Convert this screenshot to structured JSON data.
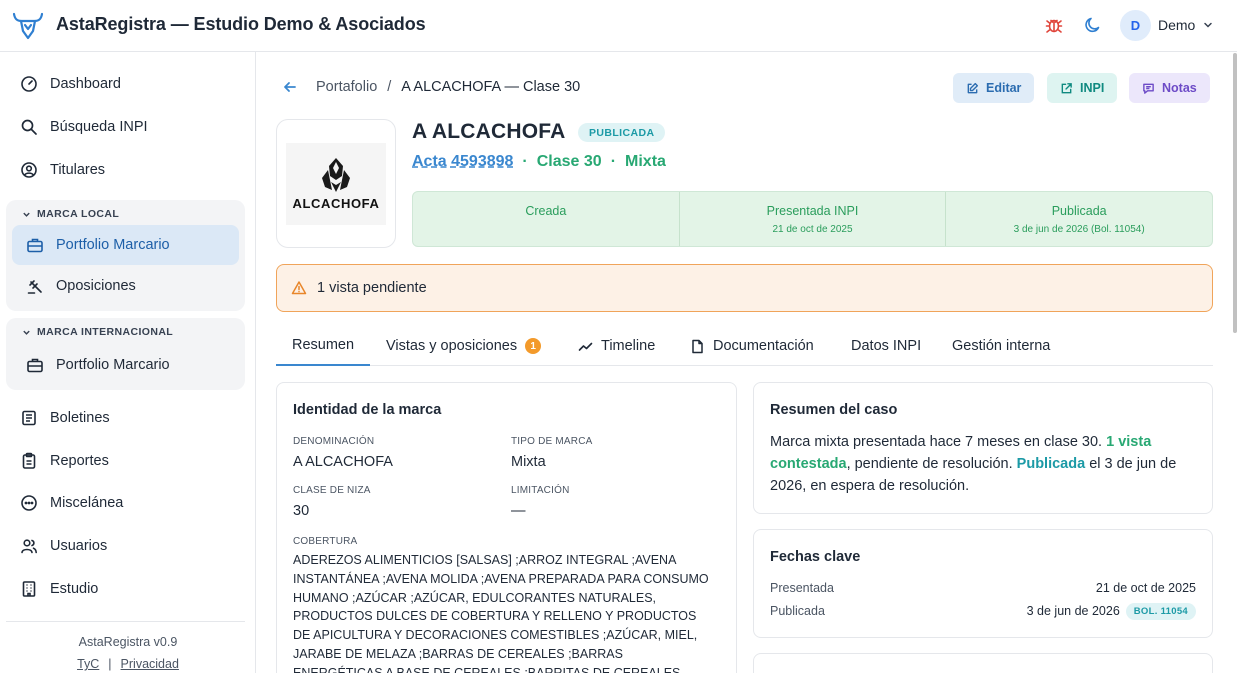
{
  "header": {
    "app_title": "AstaRegistra — Estudio Demo & Asociados",
    "user_initial": "D",
    "user_name": "Demo"
  },
  "sidebar": {
    "items_top": [
      {
        "label": "Dashboard",
        "icon": "gauge-icon"
      },
      {
        "label": "Búsqueda INPI",
        "icon": "search-icon"
      },
      {
        "label": "Titulares",
        "icon": "user-circle-icon"
      }
    ],
    "group_local": {
      "title": "MARCA LOCAL",
      "items": [
        {
          "label": "Portfolio Marcario",
          "icon": "briefcase-icon"
        },
        {
          "label": "Oposiciones",
          "icon": "gavel-icon"
        }
      ]
    },
    "group_intl": {
      "title": "MARCA INTERNACIONAL",
      "items": [
        {
          "label": "Portfolio Marcario",
          "icon": "briefcase-icon"
        }
      ]
    },
    "items_bottom": [
      {
        "label": "Boletines",
        "icon": "newspaper-icon"
      },
      {
        "label": "Reportes",
        "icon": "clipboard-icon"
      },
      {
        "label": "Miscelánea",
        "icon": "dots-circle-icon"
      },
      {
        "label": "Usuarios",
        "icon": "users-icon"
      },
      {
        "label": "Estudio",
        "icon": "building-icon"
      }
    ],
    "version": "AstaRegistra v0.9",
    "tyc": "TyC",
    "privacidad": "Privacidad"
  },
  "breadcrumb": {
    "parent": "Portafolio",
    "separator": "/",
    "current": "A ALCACHOFA — Clase 30"
  },
  "actions": {
    "edit": "Editar",
    "inpi": "INPI",
    "notes": "Notas"
  },
  "mark": {
    "logo_word": "ALCACHOFA",
    "name": "A ALCACHOFA",
    "status": "PUBLICADA",
    "acta": "Acta 4593898",
    "clase": "Clase 30",
    "tipo": "Mixta",
    "dot": "·"
  },
  "timeline": [
    {
      "label": "Creada",
      "date": ""
    },
    {
      "label": "Presentada INPI",
      "date": "21 de oct de 2025"
    },
    {
      "label": "Publicada",
      "date": "3 de jun de 2026 (Bol. 11054)"
    }
  ],
  "alert": {
    "text": "1 vista pendiente"
  },
  "tabs": [
    {
      "label": "Resumen"
    },
    {
      "label": "Vistas y oposiciones",
      "badge": "1"
    },
    {
      "label": "Timeline"
    },
    {
      "label": "Documentación"
    },
    {
      "label": "Datos INPI"
    },
    {
      "label": "Gestión interna"
    }
  ],
  "identity": {
    "title": "Identidad de la marca",
    "denominacion_label": "DENOMINACIÓN",
    "denominacion": "A ALCACHOFA",
    "tipo_label": "TIPO DE MARCA",
    "tipo": "Mixta",
    "clase_label": "CLASE DE NIZA",
    "clase": "30",
    "limitacion_label": "LIMITACIÓN",
    "limitacion": "—",
    "cobertura_label": "COBERTURA",
    "cobertura": "ADEREZOS ALIMENTICIOS [SALSAS] ;ARROZ INTEGRAL ;AVENA INSTANTÁNEA ;AVENA MOLIDA ;AVENA PREPARADA PARA CONSUMO HUMANO ;AZÚCAR ;AZÚCAR, EDULCORANTES NATURALES, PRODUCTOS DULCES DE COBERTURA Y RELLENO Y PRODUCTOS DE APICULTURA Y DECORACIONES COMESTIBLES ;AZÚCAR, MIEL, JARABE DE MELAZA ;BARRAS DE CEREALES ;BARRAS ENERGÉTICAS A BASE DE CEREALES ;BARRITAS DE CEREALES RICAS EN PROTEÍNAS ;BARRITAS DE"
  },
  "summary": {
    "title": "Resumen del caso",
    "p1": "Marca mixta presentada hace 7 meses en clase 30.",
    "h1": "1 vista contestada",
    "p2": ", pendiente de resolución.",
    "h2": "Publicada",
    "p3": "el 3 de jun de 2026, en espera de resolución."
  },
  "dates": {
    "title": "Fechas clave",
    "rows": [
      {
        "label": "Presentada",
        "value": "21 de oct de 2025",
        "badge": ""
      },
      {
        "label": "Publicada",
        "value": "3 de jun de 2026",
        "badge": "BOL. 11054"
      }
    ]
  },
  "colors": {
    "accent_blue": "#3a87cf",
    "green": "#28a873",
    "teal": "#1c9aa6",
    "warning": "#f39a2b"
  }
}
